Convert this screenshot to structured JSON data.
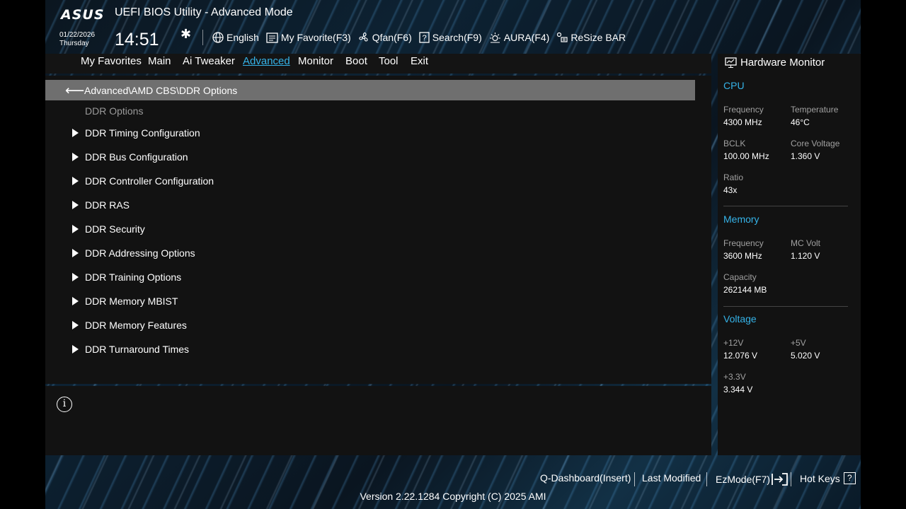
{
  "header": {
    "logo": "ASUS",
    "title": "UEFI BIOS Utility - Advanced Mode",
    "date": "01/22/2026",
    "day": "Thursday",
    "time": "14:51",
    "toolbar": [
      {
        "label": "English",
        "icon": "globe-icon"
      },
      {
        "label": "My Favorite(F3)",
        "icon": "favorite-icon"
      },
      {
        "label": "Qfan(F6)",
        "icon": "fan-icon"
      },
      {
        "label": "Search(F9)",
        "icon": "search-icon"
      },
      {
        "label": "AURA(F4)",
        "icon": "aura-icon"
      },
      {
        "label": "ReSize BAR",
        "icon": "resize-bar-icon"
      }
    ]
  },
  "tabs": [
    "My Favorites",
    "Main",
    "Ai Tweaker",
    "Advanced",
    "Monitor",
    "Boot",
    "Tool",
    "Exit"
  ],
  "active_tab": "Advanced",
  "breadcrumb": "Advanced\\AMD CBS\\DDR Options",
  "section_label": "DDR Options",
  "menu_items": [
    "DDR Timing Configuration",
    "DDR Bus Configuration",
    "DDR Controller Configuration",
    "DDR RAS",
    "DDR Security",
    "DDR Addressing Options",
    "DDR Training Options",
    "DDR Memory MBIST",
    "DDR Memory Features",
    "DDR Turnaround Times"
  ],
  "hw_monitor": {
    "title": "Hardware Monitor",
    "cpu": {
      "heading": "CPU",
      "frequency_label": "Frequency",
      "frequency": "4300 MHz",
      "temperature_label": "Temperature",
      "temperature": "46°C",
      "bclk_label": "BCLK",
      "bclk": "100.00 MHz",
      "core_voltage_label": "Core Voltage",
      "core_voltage": "1.360 V",
      "ratio_label": "Ratio",
      "ratio": "43x"
    },
    "memory": {
      "heading": "Memory",
      "frequency_label": "Frequency",
      "frequency": "3600 MHz",
      "mc_volt_label": "MC Volt",
      "mc_volt": "1.120 V",
      "capacity_label": "Capacity",
      "capacity": "262144 MB"
    },
    "voltage": {
      "heading": "Voltage",
      "v12_label": "+12V",
      "v12": "12.076 V",
      "v5_label": "+5V",
      "v5": "5.020 V",
      "v33_label": "+3.3V",
      "v33": "3.344 V"
    }
  },
  "footer": {
    "qdashboard": "Q-Dashboard(Insert)",
    "last_modified": "Last Modified",
    "ezmode": "EzMode(F7)",
    "hotkeys": "Hot Keys",
    "hotkeys_icon_text": "?",
    "version": "Version 2.22.1284 Copyright (C) 2025 AMI"
  },
  "colors": {
    "accent": "#35b3e8",
    "panel": "#121212",
    "breadcrumb_bg": "#6f6f6f"
  }
}
